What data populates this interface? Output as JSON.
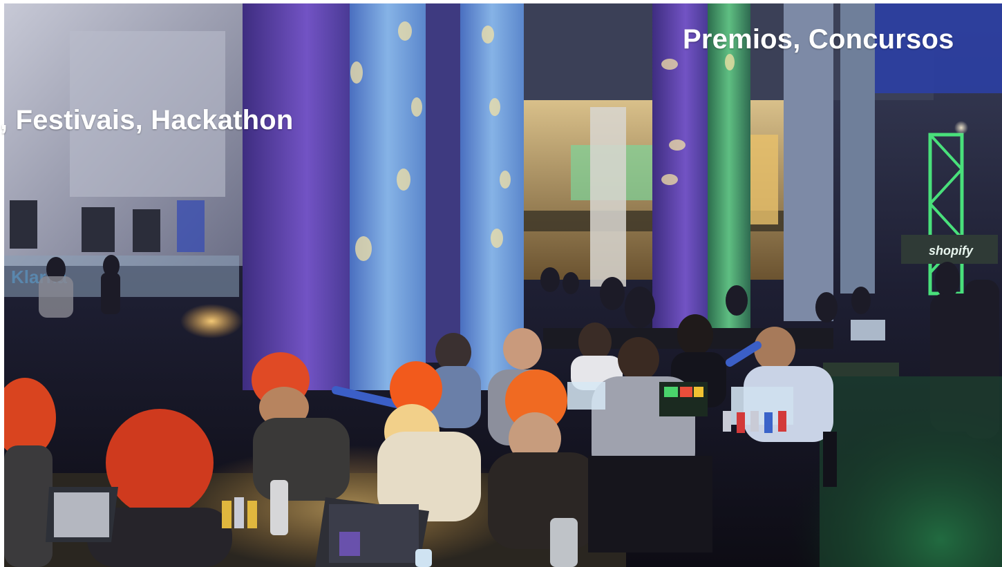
{
  "captions": {
    "left": ", Festivais, Hackathon",
    "right": "Premios, Concursos"
  },
  "photo": {
    "subject": "hackathon-venue-photo",
    "signs": {
      "shopify": "shopify",
      "klarna": "Klarna"
    },
    "colors": {
      "pillar_blue": "#5a8fd6",
      "pillar_purple": "#6a4fb0",
      "stage_green": "#3fe07a",
      "warm_light": "#f2b34a",
      "hat_red": "#d63a22",
      "background_dark": "#14131c"
    }
  }
}
